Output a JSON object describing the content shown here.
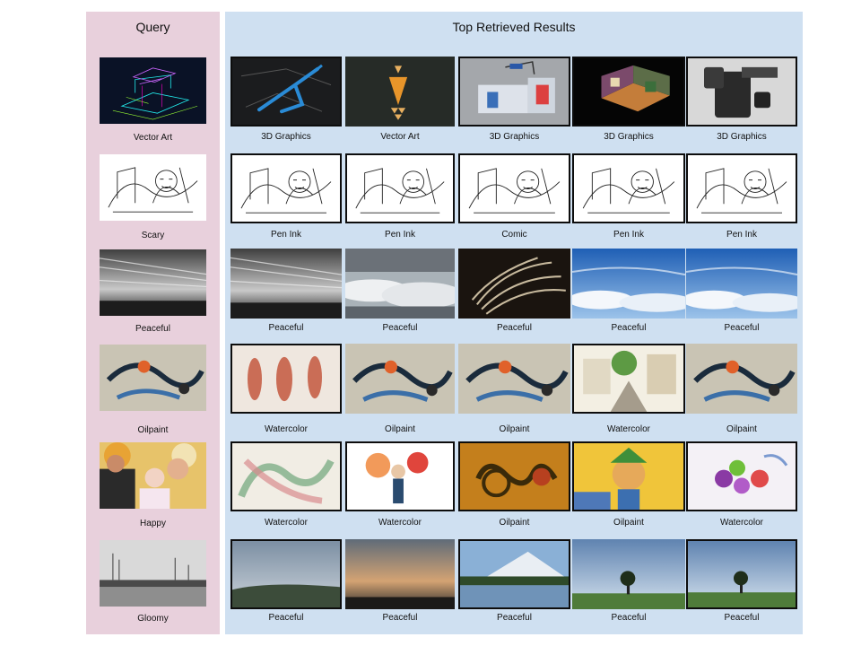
{
  "headers": {
    "query": "Query",
    "results": "Top Retrieved Results"
  },
  "rows": [
    {
      "query": {
        "label": "Vector Art",
        "scene": "cad"
      },
      "results": [
        {
          "label": "3D Graphics",
          "scene": "bike"
        },
        {
          "label": "Vector Art",
          "scene": "cone"
        },
        {
          "label": "3D Graphics",
          "scene": "booth"
        },
        {
          "label": "3D Graphics",
          "scene": "room"
        },
        {
          "label": "3D Graphics",
          "scene": "machine"
        }
      ]
    },
    {
      "query": {
        "label": "Scary",
        "scene": "sketch"
      },
      "results": [
        {
          "label": "Pen Ink",
          "scene": "sketch"
        },
        {
          "label": "Pen Ink",
          "scene": "sketch"
        },
        {
          "label": "Comic",
          "scene": "sketch"
        },
        {
          "label": "Pen Ink",
          "scene": "sketch"
        },
        {
          "label": "Pen Ink",
          "scene": "sketch"
        }
      ]
    },
    {
      "query": {
        "label": "Peaceful",
        "scene": "storm"
      },
      "results": [
        {
          "label": "Peaceful",
          "scene": "storm"
        },
        {
          "label": "Peaceful",
          "scene": "clouds"
        },
        {
          "label": "Peaceful",
          "scene": "fur"
        },
        {
          "label": "Peaceful",
          "scene": "sky"
        },
        {
          "label": "Peaceful",
          "scene": "sky"
        }
      ]
    },
    {
      "query": {
        "label": "Oilpaint",
        "scene": "abstract"
      },
      "results": [
        {
          "label": "Watercolor",
          "scene": "figures"
        },
        {
          "label": "Oilpaint",
          "scene": "abstract"
        },
        {
          "label": "Oilpaint",
          "scene": "abstract"
        },
        {
          "label": "Watercolor",
          "scene": "village"
        },
        {
          "label": "Oilpaint",
          "scene": "abstract"
        }
      ]
    },
    {
      "query": {
        "label": "Happy",
        "scene": "family"
      },
      "results": [
        {
          "label": "Watercolor",
          "scene": "petals"
        },
        {
          "label": "Watercolor",
          "scene": "flowers"
        },
        {
          "label": "Oilpaint",
          "scene": "snake"
        },
        {
          "label": "Oilpaint",
          "scene": "clown"
        },
        {
          "label": "Watercolor",
          "scene": "fruit"
        }
      ]
    },
    {
      "query": {
        "label": "Gloomy",
        "scene": "fog"
      },
      "results": [
        {
          "label": "Peaceful",
          "scene": "landscape"
        },
        {
          "label": "Peaceful",
          "scene": "dusk"
        },
        {
          "label": "Peaceful",
          "scene": "mountain"
        },
        {
          "label": "Peaceful",
          "scene": "tree"
        },
        {
          "label": "Peaceful",
          "scene": "tree"
        }
      ]
    }
  ]
}
